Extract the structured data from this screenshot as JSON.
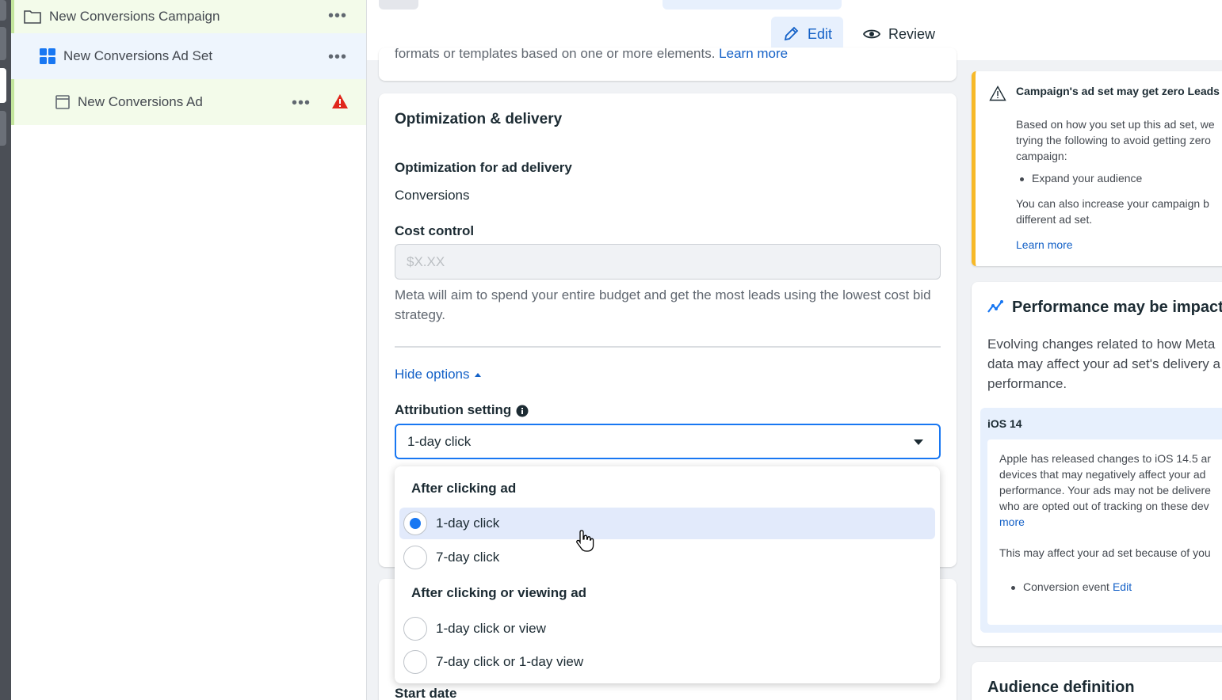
{
  "tree": {
    "campaign_label": "New Conversions Campaign",
    "adset_label": "New Conversions Ad Set",
    "ad_label": "New Conversions Ad",
    "more_glyph": "•••"
  },
  "toolbar": {
    "edit_label": "Edit",
    "review_label": "Review"
  },
  "main": {
    "truncated_text": "formats or templates based on one or more elements.",
    "truncated_link": "Learn more",
    "section_title": "Optimization & delivery",
    "optimization_label": "Optimization for ad delivery",
    "optimization_value": "Conversions",
    "cost_control_label": "Cost control",
    "cost_control_placeholder": "$X.XX",
    "cost_control_help": "Meta will aim to spend your entire budget and get the most leads using the lowest cost bid strategy.",
    "hide_options_label": "Hide options",
    "attribution_label": "Attribution setting",
    "attribution_value": "1-day click",
    "start_date_label": "Start date"
  },
  "dropdown": {
    "group1_header": "After clicking ad",
    "group2_header": "After clicking or viewing ad",
    "options": [
      {
        "label": "1-day click",
        "selected": true
      },
      {
        "label": "7-day click",
        "selected": false
      },
      {
        "label": "1-day click or view",
        "selected": false
      },
      {
        "label": "7-day click or 1-day view",
        "selected": false
      }
    ]
  },
  "alert": {
    "title": "Campaign's ad set may get zero Leads",
    "body_lines": [
      "Based on how you set up this ad set, we",
      "trying the following to avoid getting zero",
      "campaign:"
    ],
    "bullet": "Expand your audience",
    "body2_lines": [
      "You can also increase your campaign b",
      "different ad set."
    ],
    "link": "Learn more"
  },
  "performance": {
    "title": "Performance may be impacte",
    "body_lines": [
      "Evolving changes related to how Meta",
      "data may affect your ad set's delivery a",
      "performance."
    ],
    "ios_title": "iOS 14",
    "ios_body_lines": [
      "Apple has released changes to iOS 14.5 ar",
      "devices that may negatively affect your ad",
      "performance. Your ads may not be delivere",
      "who are opted out of tracking on these dev"
    ],
    "ios_more": "more",
    "ios_body2": "This may affect your ad set because of you",
    "ios_bullet": "Conversion event",
    "ios_edit": "Edit"
  },
  "audience": {
    "title": "Audience definition"
  },
  "colors": {
    "accent": "#1877f2",
    "link": "#1461c7",
    "warning": "#f7b928",
    "error": "#e0261b"
  }
}
